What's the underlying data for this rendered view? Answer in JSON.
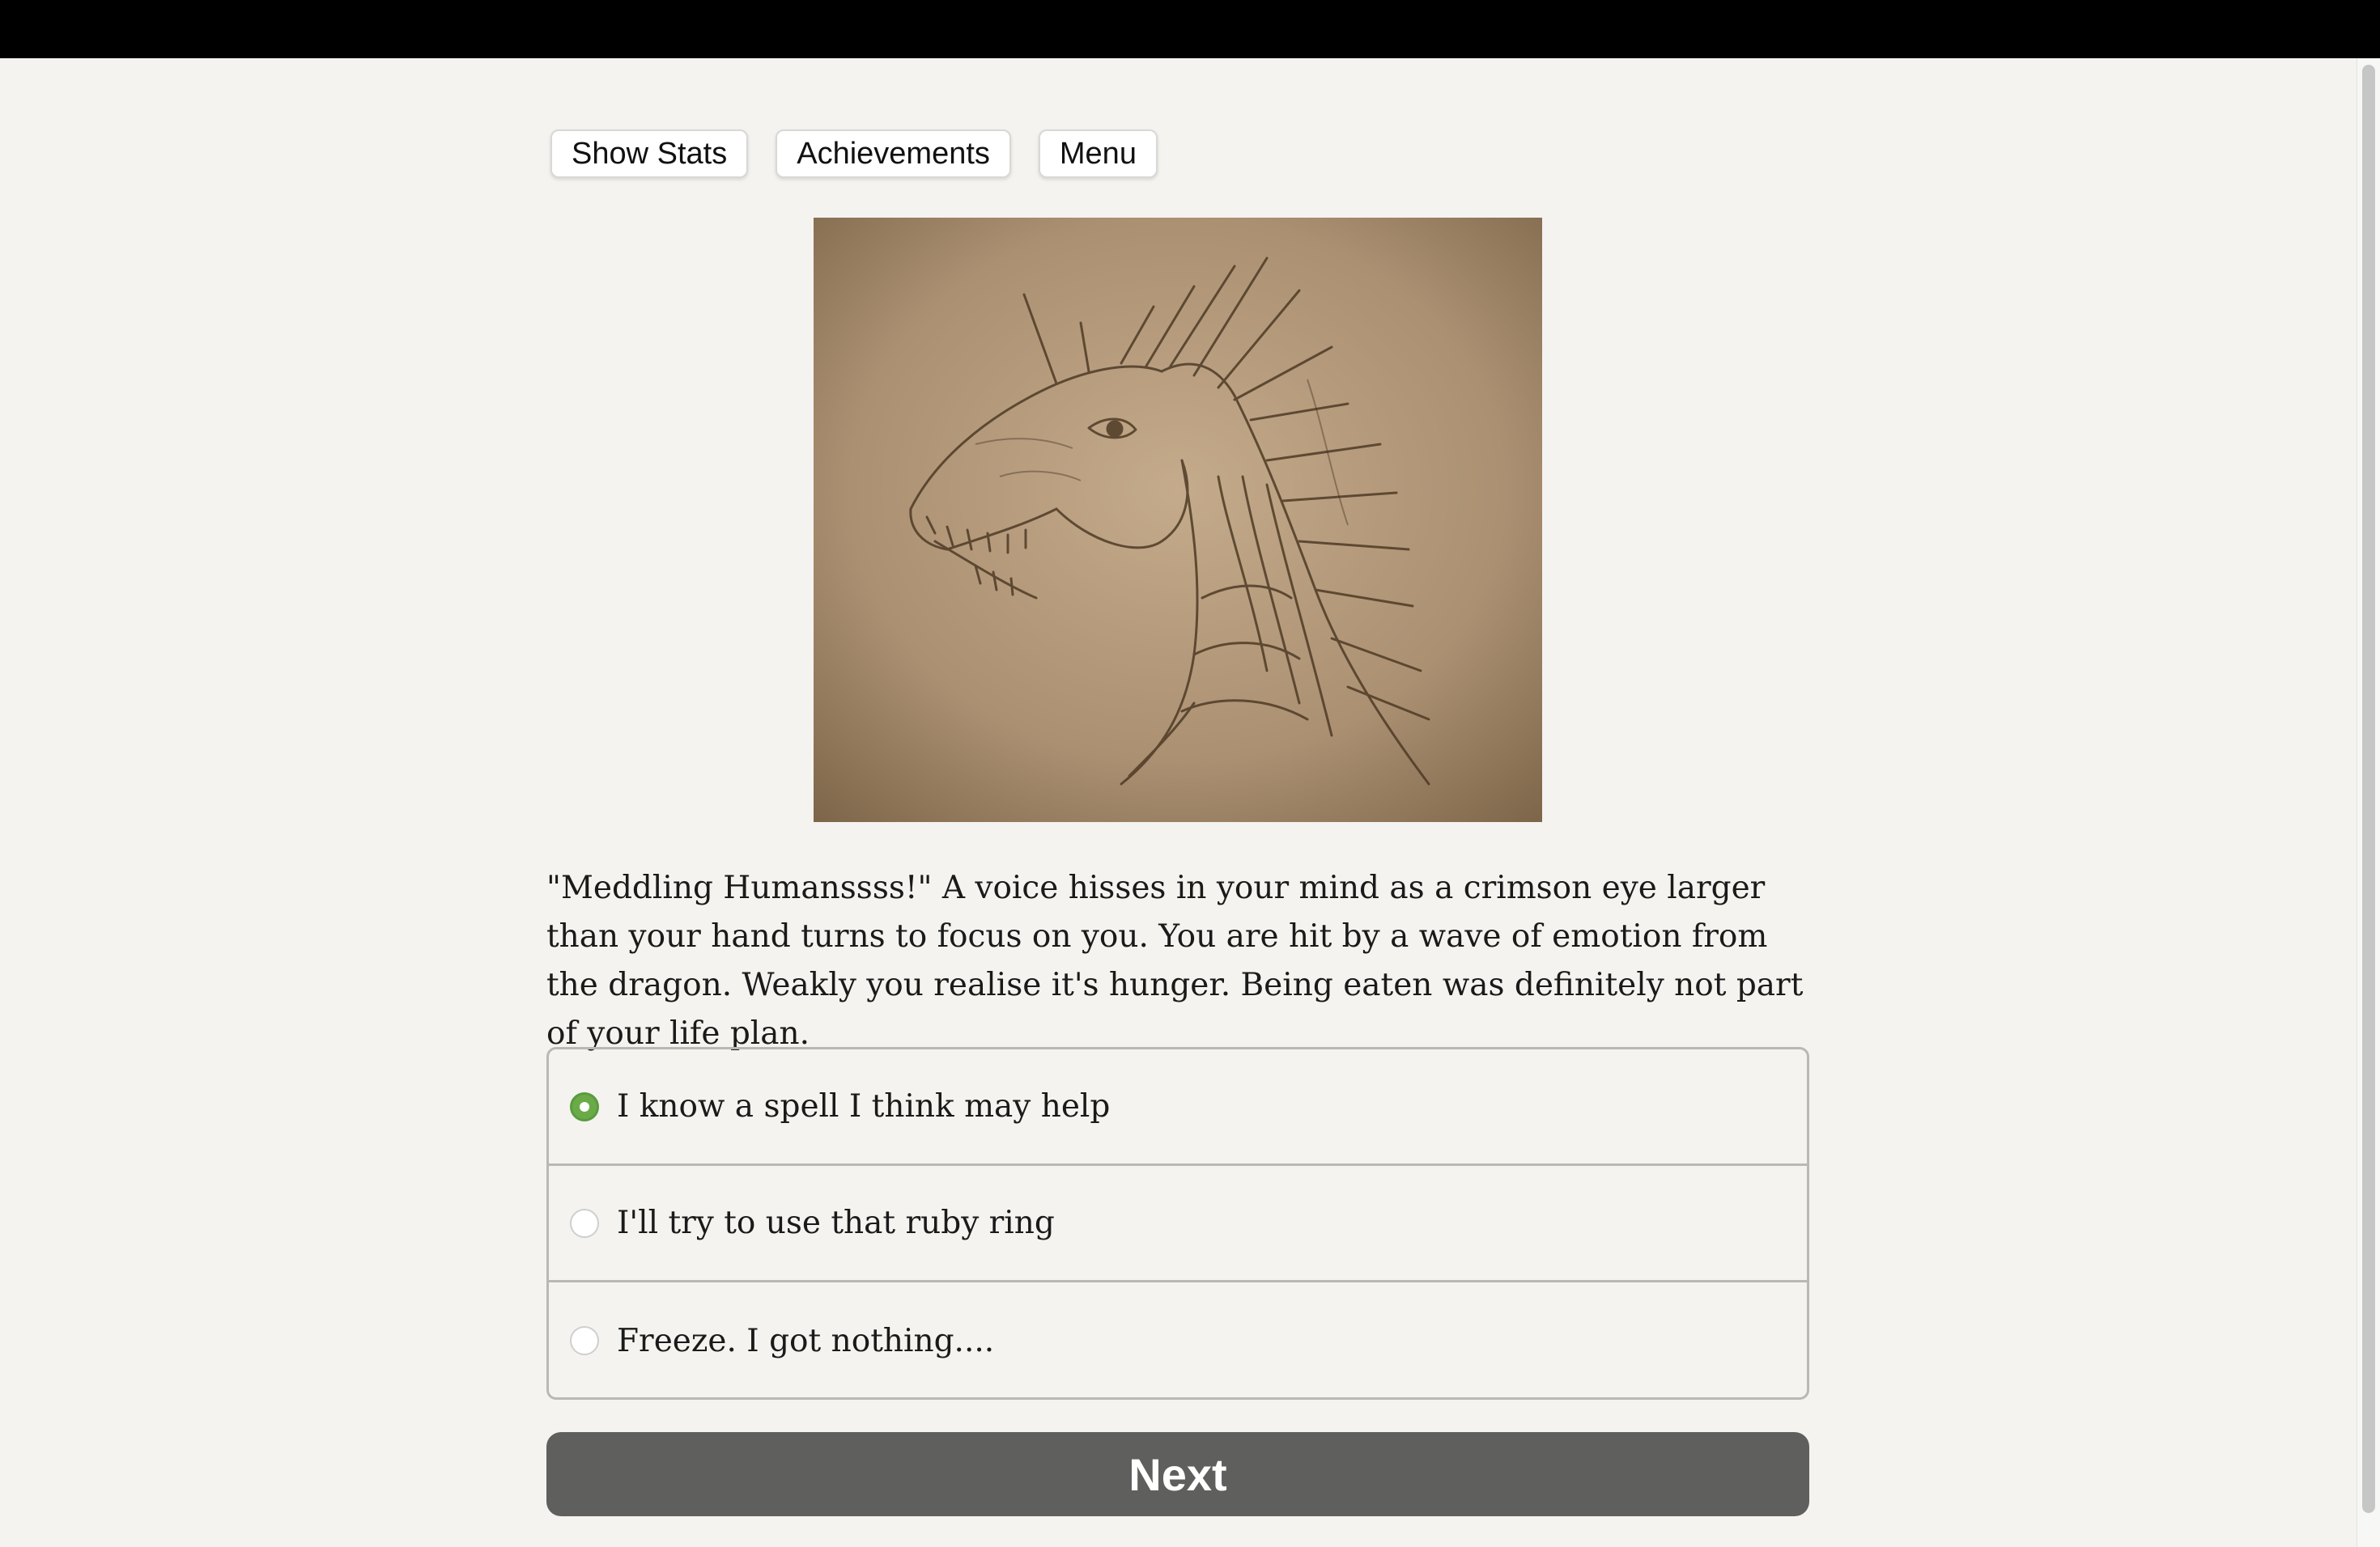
{
  "toolbar": {
    "show_stats": "Show Stats",
    "achievements": "Achievements",
    "menu": "Menu"
  },
  "illustration": {
    "subject": "dragon-head-sketch",
    "tone_color": "#8a6f4e"
  },
  "story": {
    "text": "\"Meddling Humanssss!\" A voice hisses in your mind as a crimson eye larger than your hand turns to focus on you. You are hit by a wave of emotion from the dragon. Weakly you realise it's hunger. Being eaten was definitely not part of your life plan."
  },
  "choices": [
    {
      "label": "I know a spell I think may help",
      "selected": true
    },
    {
      "label": "I'll try to use that ruby ring",
      "selected": false
    },
    {
      "label": "Freeze. I got nothing....",
      "selected": false
    }
  ],
  "next_label": "Next",
  "colors": {
    "background": "#f4f3ef",
    "accent_selected": "#6aab47",
    "next_button": "#5f5f5e"
  }
}
